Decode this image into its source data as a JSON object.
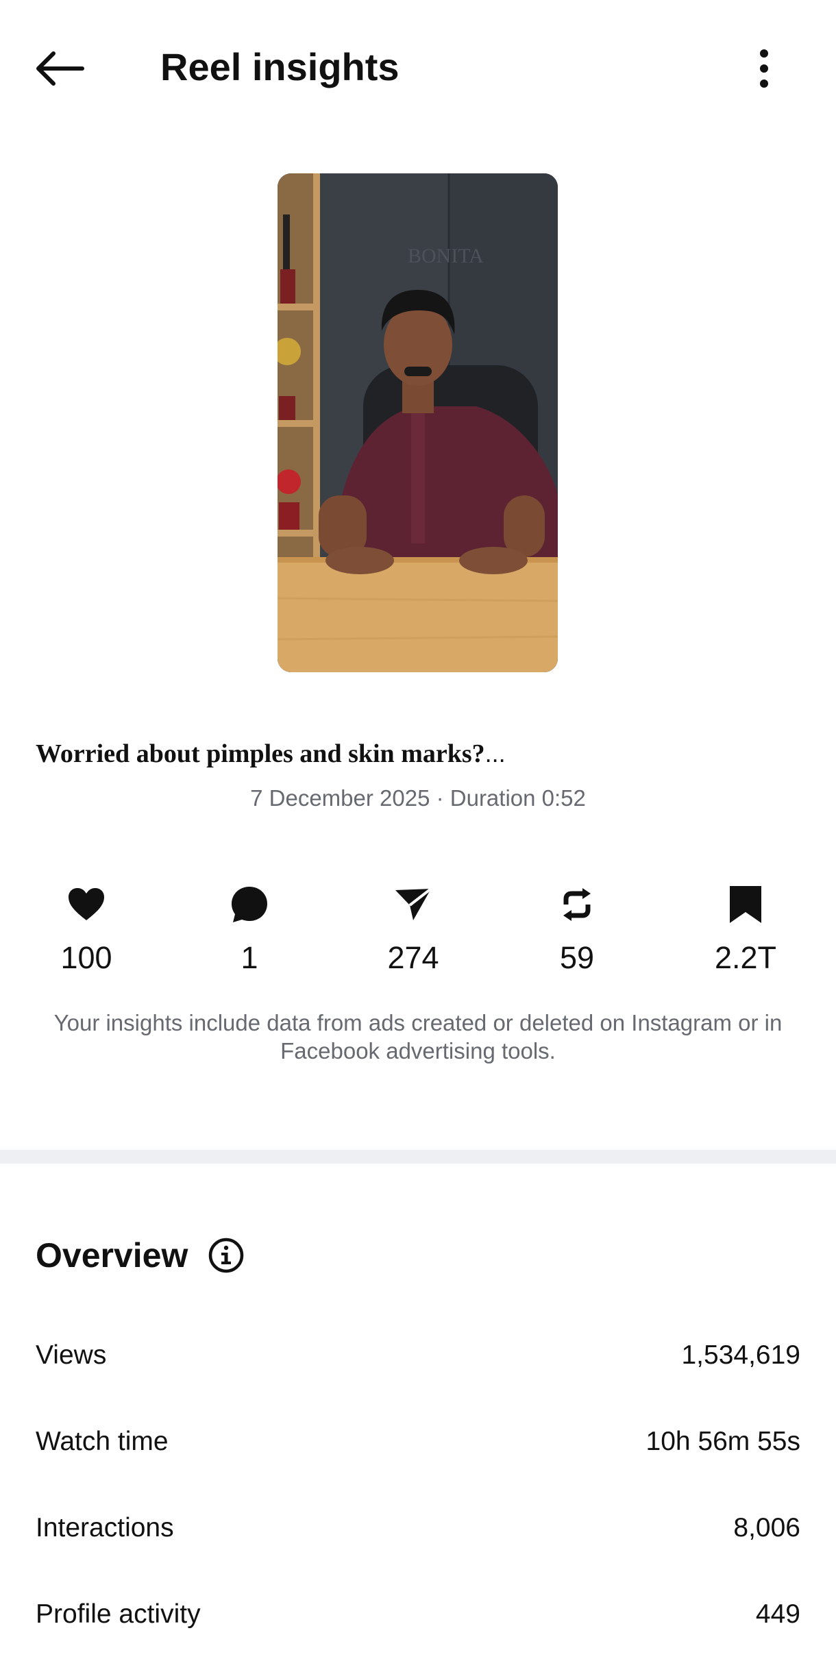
{
  "header": {
    "title": "Reel insights",
    "back_icon": "arrow-left-icon",
    "menu_icon": "more-vertical-icon"
  },
  "reel": {
    "thumbnail_description_icon": "video-thumbnail",
    "caption": "Worried about pimples and skin marks?",
    "caption_ellipsis": "...",
    "meta": "7 December 2025 · Duration 0:52"
  },
  "stats": [
    {
      "icon": "heart-icon",
      "value": "100"
    },
    {
      "icon": "comment-icon",
      "value": "1"
    },
    {
      "icon": "share-icon",
      "value": "274"
    },
    {
      "icon": "repost-icon",
      "value": "59"
    },
    {
      "icon": "bookmark-icon",
      "value": "2.2T"
    }
  ],
  "notice": "Your insights include data from ads created or deleted on Instagram or in Facebook advertising tools.",
  "overview": {
    "title": "Overview",
    "info_icon": "info-icon",
    "rows": [
      {
        "label": "Views",
        "value": "1,534,619"
      },
      {
        "label": "Watch time",
        "value": "10h 56m 55s"
      },
      {
        "label": "Interactions",
        "value": "8,006"
      },
      {
        "label": "Profile activity",
        "value": "449"
      }
    ]
  },
  "colors": {
    "text_primary": "#111111",
    "text_secondary": "#666a70",
    "divider": "#eeeff2",
    "background": "#ffffff"
  }
}
